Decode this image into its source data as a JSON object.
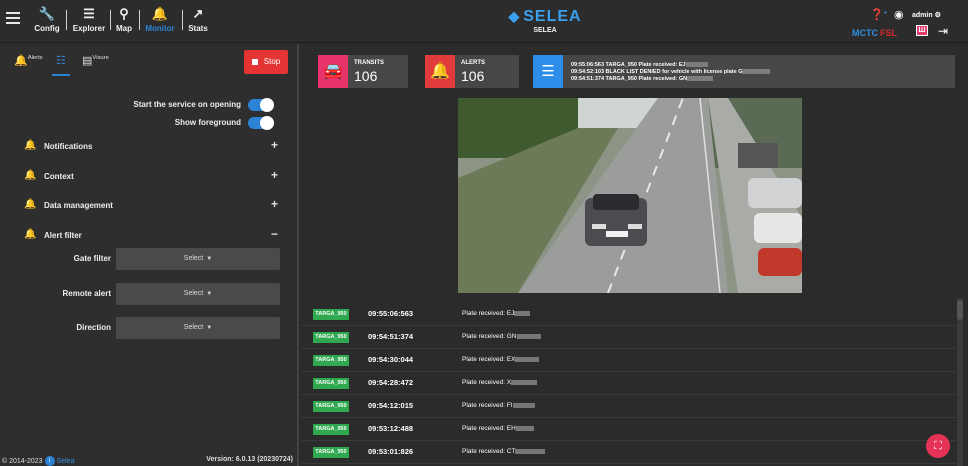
{
  "topbar": {
    "nav": [
      {
        "label": "Config",
        "icon": "wrench-icon"
      },
      {
        "label": "Explorer",
        "icon": "search-list-icon"
      },
      {
        "label": "Map",
        "icon": "map-pin-icon"
      },
      {
        "label": "Monitor",
        "icon": "bell-icon",
        "active": true
      },
      {
        "label": "Stats",
        "icon": "chart-icon"
      }
    ],
    "brand": {
      "logo": "SELEA",
      "subtitle": "SELEA"
    },
    "user": "admin",
    "mctc": "MCTC",
    "red_label": "FSL"
  },
  "left": {
    "tabs": [
      {
        "label": "Alerts",
        "icon": "alarm-icon"
      },
      {
        "label": "",
        "icon": "sliders-icon",
        "active": true
      },
      {
        "label": "Visure",
        "icon": "list-icon"
      }
    ],
    "stop_label": "Stop",
    "toggles": [
      {
        "label": "Start the service on opening",
        "on": true
      },
      {
        "label": "Show foreground",
        "on": true
      }
    ],
    "sections": [
      {
        "label": "Notifications",
        "sign": "+"
      },
      {
        "label": "Context",
        "sign": "+"
      },
      {
        "label": "Data management",
        "sign": "+"
      },
      {
        "label": "Alert filter",
        "sign": "−"
      }
    ],
    "filters": [
      {
        "label": "Gate filter",
        "value": "Select"
      },
      {
        "label": "Remote alert",
        "value": "Select"
      },
      {
        "label": "Direction",
        "value": "Select"
      }
    ],
    "footer": {
      "copyright": "© 2014-2023",
      "link": "Selea",
      "version": "Version: 6.0.13 (20230724)"
    }
  },
  "right": {
    "transits": {
      "title": "TRANSITS",
      "value": "106",
      "color": "#e8336a"
    },
    "alerts": {
      "title": "ALERTS",
      "value": "106",
      "color": "#e23b3b"
    },
    "log": [
      "09:55:06:563 TARGA_950 Plate received: EJ",
      "09:54:52:103 BLACK LIST DENIED for vehicle with license plate G",
      "09:54:51:374 TARGA_950 Plate received: GN"
    ],
    "rows": [
      {
        "gate": "TARGA_950",
        "time": "09:55:06:563",
        "msg": "Plate received: EJ"
      },
      {
        "gate": "TARGA_950",
        "time": "09:54:51:374",
        "msg": "Plate received: GN"
      },
      {
        "gate": "TARGA_950",
        "time": "09:54:30:044",
        "msg": "Plate received: EX"
      },
      {
        "gate": "TARGA_950",
        "time": "09:54:28:472",
        "msg": "Plate received: X"
      },
      {
        "gate": "TARGA_950",
        "time": "09:54:12:015",
        "msg": "Plate received: FI"
      },
      {
        "gate": "TARGA_950",
        "time": "09:53:12:488",
        "msg": "Plate received: EH"
      },
      {
        "gate": "TARGA_950",
        "time": "09:53:01:826",
        "msg": "Plate received: CT"
      }
    ]
  }
}
